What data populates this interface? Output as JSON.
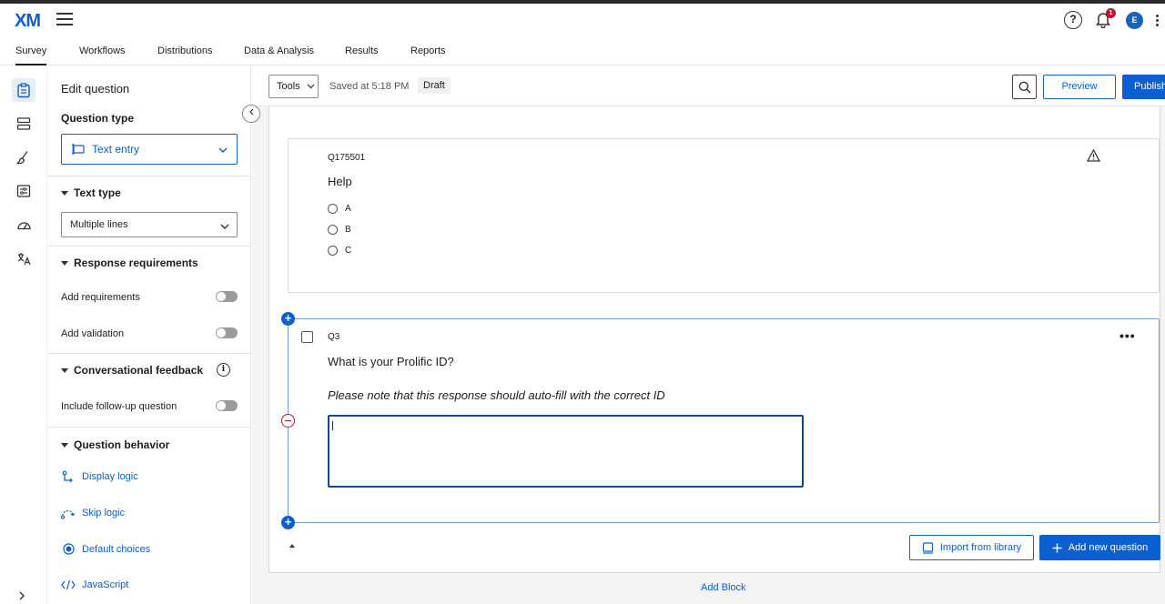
{
  "header": {
    "logo": "XM",
    "help": "?",
    "notif_count": "1",
    "avatar_initial": "E"
  },
  "tabs": [
    "Survey",
    "Workflows",
    "Distributions",
    "Data & Analysis",
    "Results",
    "Reports"
  ],
  "panel": {
    "title": "Edit question",
    "question_type_label": "Question type",
    "question_type_value": "Text entry",
    "text_type_label": "Text type",
    "text_type_value": "Multiple lines",
    "response_req_label": "Response requirements",
    "add_requirements": "Add requirements",
    "add_validation": "Add validation",
    "conv_feedback_label": "Conversational feedback",
    "include_followup": "Include follow-up question",
    "behavior_label": "Question behavior",
    "display_logic": "Display logic",
    "skip_logic": "Skip logic",
    "default_choices": "Default choices",
    "javascript": "JavaScript"
  },
  "toolbar": {
    "tools": "Tools",
    "saved": "Saved at 5:18 PM",
    "draft": "Draft",
    "preview": "Preview",
    "publish": "Publish"
  },
  "question1": {
    "id": "Q175501",
    "text": "Help",
    "choices": [
      "A",
      "B",
      "C"
    ]
  },
  "question2": {
    "id": "Q3",
    "text": "What is your Prolific ID?",
    "note": "Please note that this response should auto-fill with the correct ID"
  },
  "actions": {
    "import": "Import from library",
    "add_question": "Add new question",
    "add_block": "Add Block"
  },
  "colors": {
    "accent": "#0b5fd1",
    "danger": "#c8102e"
  }
}
